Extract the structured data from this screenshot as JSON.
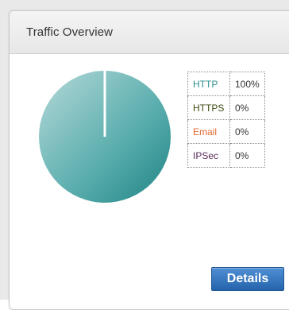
{
  "panel": {
    "title": "Traffic Overview"
  },
  "pie": {
    "share": 1.0,
    "gradient_light": "#a9d2d2",
    "gradient_dark": "#1f8585",
    "divider_color": "#ffffff"
  },
  "legend": [
    {
      "label": "HTTP",
      "value": "100%",
      "color": "#2f8f8f"
    },
    {
      "label": "HTTPS",
      "value": "0%",
      "color": "#3d4a12"
    },
    {
      "label": "Email",
      "value": "0%",
      "color": "#e0692f"
    },
    {
      "label": "IPSec",
      "value": "0%",
      "color": "#5a2a5a"
    }
  ],
  "actions": {
    "details_label": "Details"
  },
  "colors": {
    "button": "#2f6db4"
  }
}
